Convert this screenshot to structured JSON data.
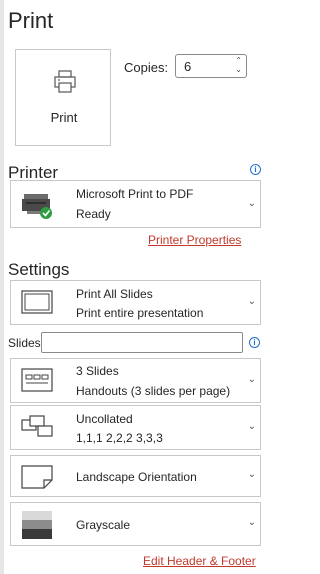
{
  "title": "Print",
  "print_button": {
    "label": "Print",
    "icon": "printer-icon"
  },
  "copies": {
    "label": "Copies:",
    "value": "6"
  },
  "printer": {
    "heading": "Printer",
    "name": "Microsoft Print to PDF",
    "status": "Ready",
    "properties_link": "Printer Properties"
  },
  "settings": {
    "heading": "Settings",
    "slides_label": "Slides:",
    "slides_value": "",
    "range": {
      "title": "Print All Slides",
      "subtitle": "Print entire presentation"
    },
    "layout": {
      "title": "3 Slides",
      "subtitle": "Handouts (3 slides per page)"
    },
    "collation": {
      "title": "Uncollated",
      "subtitle": "1,1,1   2,2,2   3,3,3"
    },
    "orientation": {
      "title": "Landscape Orientation"
    },
    "color": {
      "title": "Grayscale"
    },
    "header_footer_link": "Edit Header & Footer"
  },
  "colors": {
    "link": "#c0392b",
    "info": "#1f6ed4",
    "border": "#c8c8c8"
  }
}
